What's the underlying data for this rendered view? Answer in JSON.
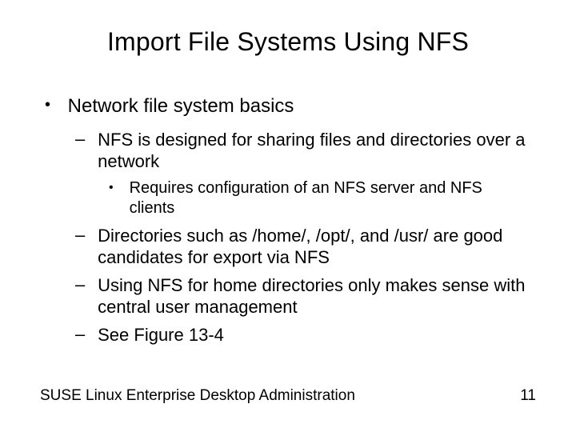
{
  "title": "Import File Systems Using NFS",
  "bullets": {
    "lvl1": "Network file system basics",
    "lvl2a": "NFS is designed for sharing files and directories over a network",
    "lvl3a": "Requires configuration of an NFS server and NFS clients",
    "lvl2b": "Directories such as /home/, /opt/, and /usr/ are good candidates for export via NFS",
    "lvl2c": "Using NFS for home directories only makes sense with central user management",
    "lvl2d": "See Figure 13-4"
  },
  "footer": {
    "left": "SUSE Linux Enterprise Desktop Administration",
    "right": "11"
  },
  "glyphs": {
    "dot": "•",
    "dash": "–"
  }
}
